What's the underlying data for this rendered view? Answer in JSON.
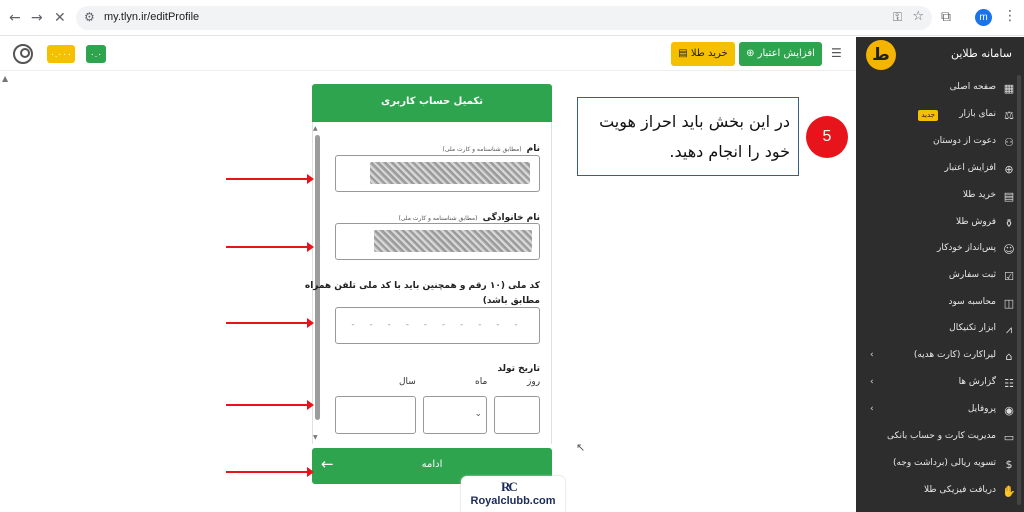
{
  "browser": {
    "url": "my.tlyn.ir/editProfile",
    "profile_initial": "m"
  },
  "header": {
    "balance_gold": "۰.۰۰۰",
    "balance_cash": "۰.۰",
    "buy_gold_label": "خرید طلا",
    "increase_credit_label": "افزایش اعتبار"
  },
  "sidebar": {
    "brand_name": "سامانه طلاین",
    "brand_letter": "ط",
    "new_tag": "جدید",
    "items": [
      {
        "label": "صفحه اصلی",
        "icon": "grid-icon"
      },
      {
        "label": "نمای بازار",
        "icon": "market-icon"
      },
      {
        "label": "دعوت از دوستان",
        "icon": "friends-icon"
      },
      {
        "label": "افزایش اعتبار",
        "icon": "plus-circle-icon"
      },
      {
        "label": "خرید طلا",
        "icon": "gold-bars-icon"
      },
      {
        "label": "فروش طلا",
        "icon": "money-bag-icon"
      },
      {
        "label": "پس‌انداز خودکار",
        "icon": "robot-icon"
      },
      {
        "label": "ثبت سفارش",
        "icon": "clipboard-icon"
      },
      {
        "label": "محاسبه سود",
        "icon": "chart-icon"
      },
      {
        "label": "ابزار تکنیکال",
        "icon": "trend-icon"
      },
      {
        "label": "لیراکارت (کارت هدیه)",
        "icon": "gift-icon"
      },
      {
        "label": "گزارش ها",
        "icon": "report-icon"
      },
      {
        "label": "پروفایل",
        "icon": "profile-icon"
      },
      {
        "label": "مدیریت کارت و حساب بانکی",
        "icon": "card-icon"
      },
      {
        "label": "تسویه ریالی (برداشت وجه)",
        "icon": "dollar-circle-icon"
      },
      {
        "label": "دریافت فیزیکی طلا",
        "icon": "hand-gold-icon"
      }
    ]
  },
  "form": {
    "title": "تکمیل حساب کاربری",
    "first_name_label": "نام",
    "first_name_hint": "(مطابق شناسنامه و کارت ملی)",
    "last_name_label": "نام خانوادگی",
    "last_name_hint": "(مطابق شناسنامه و کارت ملی)",
    "national_code_label_1": "کد ملی (۱۰ رقم و همچنین باید با کد ملی تلفن همراه",
    "national_code_label_2": "مطابق باشد)",
    "national_code_placeholder": "- - - - - - - - - -",
    "birth_date_label": "تاریخ تولد",
    "day_label": "روز",
    "month_label": "ماه",
    "year_label": "سال",
    "submit_label": "ادامه"
  },
  "annotation": {
    "step_number": "5",
    "text": "در این بخش باید احراز هویت خود را انجام دهید."
  },
  "watermark": {
    "logo": "RC",
    "text": "Royalclubb.com"
  }
}
